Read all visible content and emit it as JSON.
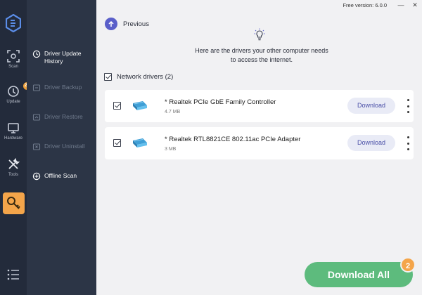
{
  "window": {
    "version": "Free version: 6.0.0",
    "minimize_glyph": "—",
    "close_glyph": "✕"
  },
  "rail": {
    "items": [
      {
        "label": "Scan",
        "icon": "scan-icon"
      },
      {
        "label": "Update",
        "icon": "update-icon",
        "badge": "25"
      },
      {
        "label": "Hardware",
        "icon": "hardware-icon"
      },
      {
        "label": "Tools",
        "icon": "tools-icon"
      },
      {
        "label": "",
        "icon": "key-icon",
        "active": true
      }
    ],
    "accent": "#f4a54a"
  },
  "subnav": {
    "items": [
      {
        "label": "Driver Update History",
        "active": true
      },
      {
        "label": "Driver Backup",
        "active": false
      },
      {
        "label": "Driver Restore",
        "active": false
      },
      {
        "label": "Driver Uninstall",
        "active": false
      },
      {
        "label": "Offline Scan",
        "active": true
      }
    ]
  },
  "main": {
    "previous_label": "Previous",
    "message_line1": "Here are the drivers your other computer needs",
    "message_line2": "to access the internet.",
    "section_label": "Network drivers (2)",
    "drivers": [
      {
        "name": "* Realtek PCIe GbE Family Controller",
        "size": "4.7 MB",
        "button": "Download",
        "checked": true
      },
      {
        "name": "* Realtek RTL8821CE 802.11ac PCIe Adapter",
        "size": "3 MB",
        "button": "Download",
        "checked": true
      }
    ],
    "download_all": "Download All",
    "download_all_count": "2",
    "colors": {
      "primary": "#5a5fc9",
      "success": "#5dbb7d",
      "badge": "#f4a54a"
    }
  }
}
